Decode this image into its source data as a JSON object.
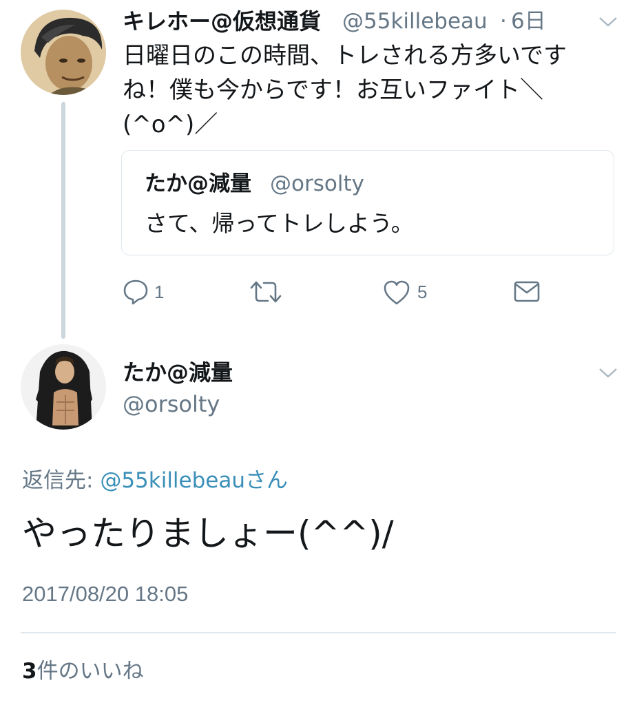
{
  "original_tweet": {
    "display_name": "キレホー@仮想通貨",
    "handle": "@55killebeau",
    "separator": "·",
    "time": "6日",
    "text_lines": [
      "日曜日のこの時間、トレされる方多いです",
      "ね！僕も今からです！お互いファイト＼",
      "(^o^)／"
    ],
    "quoted": {
      "display_name": "たか@減量",
      "handle": "@orsolty",
      "text": "さて、帰ってトレしよう。"
    },
    "actions": {
      "reply_count": "1",
      "retweet_count": "",
      "like_count": "5"
    },
    "icons": [
      "reply-icon",
      "retweet-icon",
      "like-icon",
      "dm-icon",
      "chevron-down-icon"
    ]
  },
  "reply_tweet": {
    "display_name": "たか@減量",
    "handle": "@orsolty",
    "reply_to_label": "返信先: ",
    "reply_to_handle": "@55killebeau",
    "reply_to_suffix": "さん",
    "text": "やったりましょー(^^)/",
    "timestamp": "2017/08/20 18:05",
    "likes_count": "3",
    "likes_label": "件のいいね"
  },
  "colors": {
    "text_primary": "#14171a",
    "text_secondary": "#657786",
    "link": "#3a8fb8",
    "border": "#e1e8ed",
    "thread_line": "#ccd6dd"
  }
}
